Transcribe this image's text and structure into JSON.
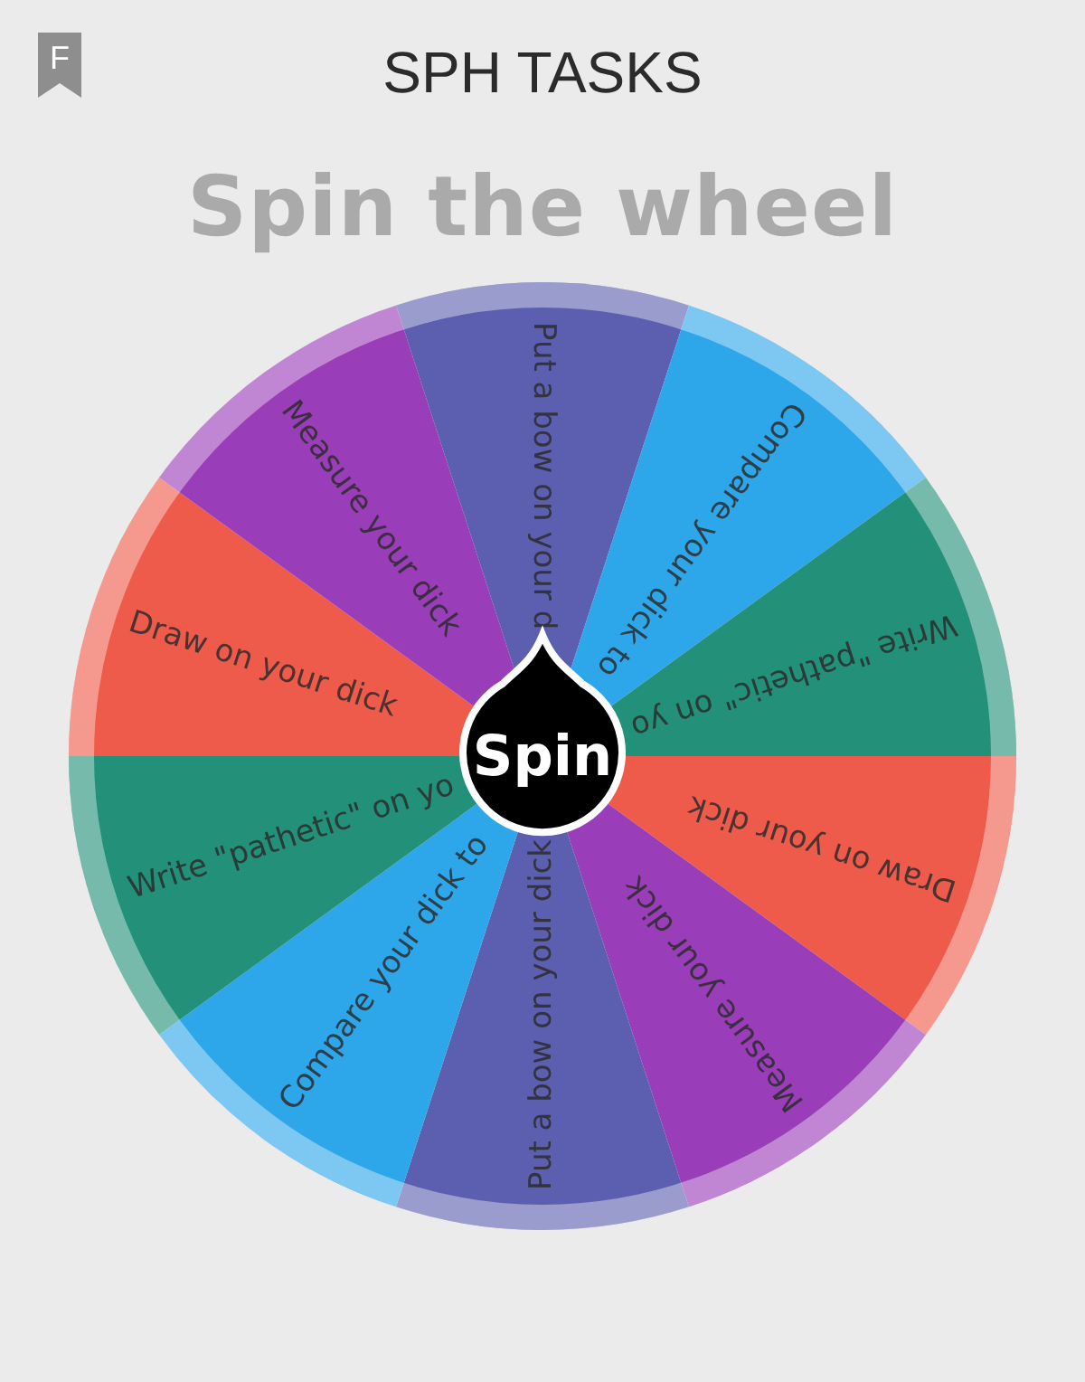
{
  "header": {
    "badge": "F",
    "title": "SPH TASKS"
  },
  "heading": "Spin the wheel",
  "wheel": {
    "segments": [
      {
        "label": "Put a bow on your d",
        "color": "#5c5fb0"
      },
      {
        "label": "Compare your dick to",
        "color": "#2ea6ea"
      },
      {
        "label": "Write \"pathetic\" on yo",
        "color": "#23907a"
      },
      {
        "label": "Draw on your dick",
        "color": "#ef5b4b"
      },
      {
        "label": "Measure your dick",
        "color": "#9a3db8"
      },
      {
        "label": "Put a bow on your dick",
        "color": "#5c5fb0"
      },
      {
        "label": "Compare your dick to",
        "color": "#2ea6ea"
      },
      {
        "label": "Write \"pathetic\" on yo",
        "color": "#23907a"
      },
      {
        "label": "Draw on your dick",
        "color": "#ef5b4b"
      },
      {
        "label": "Measure your dick",
        "color": "#9a3db8"
      }
    ],
    "button": "Spin"
  }
}
